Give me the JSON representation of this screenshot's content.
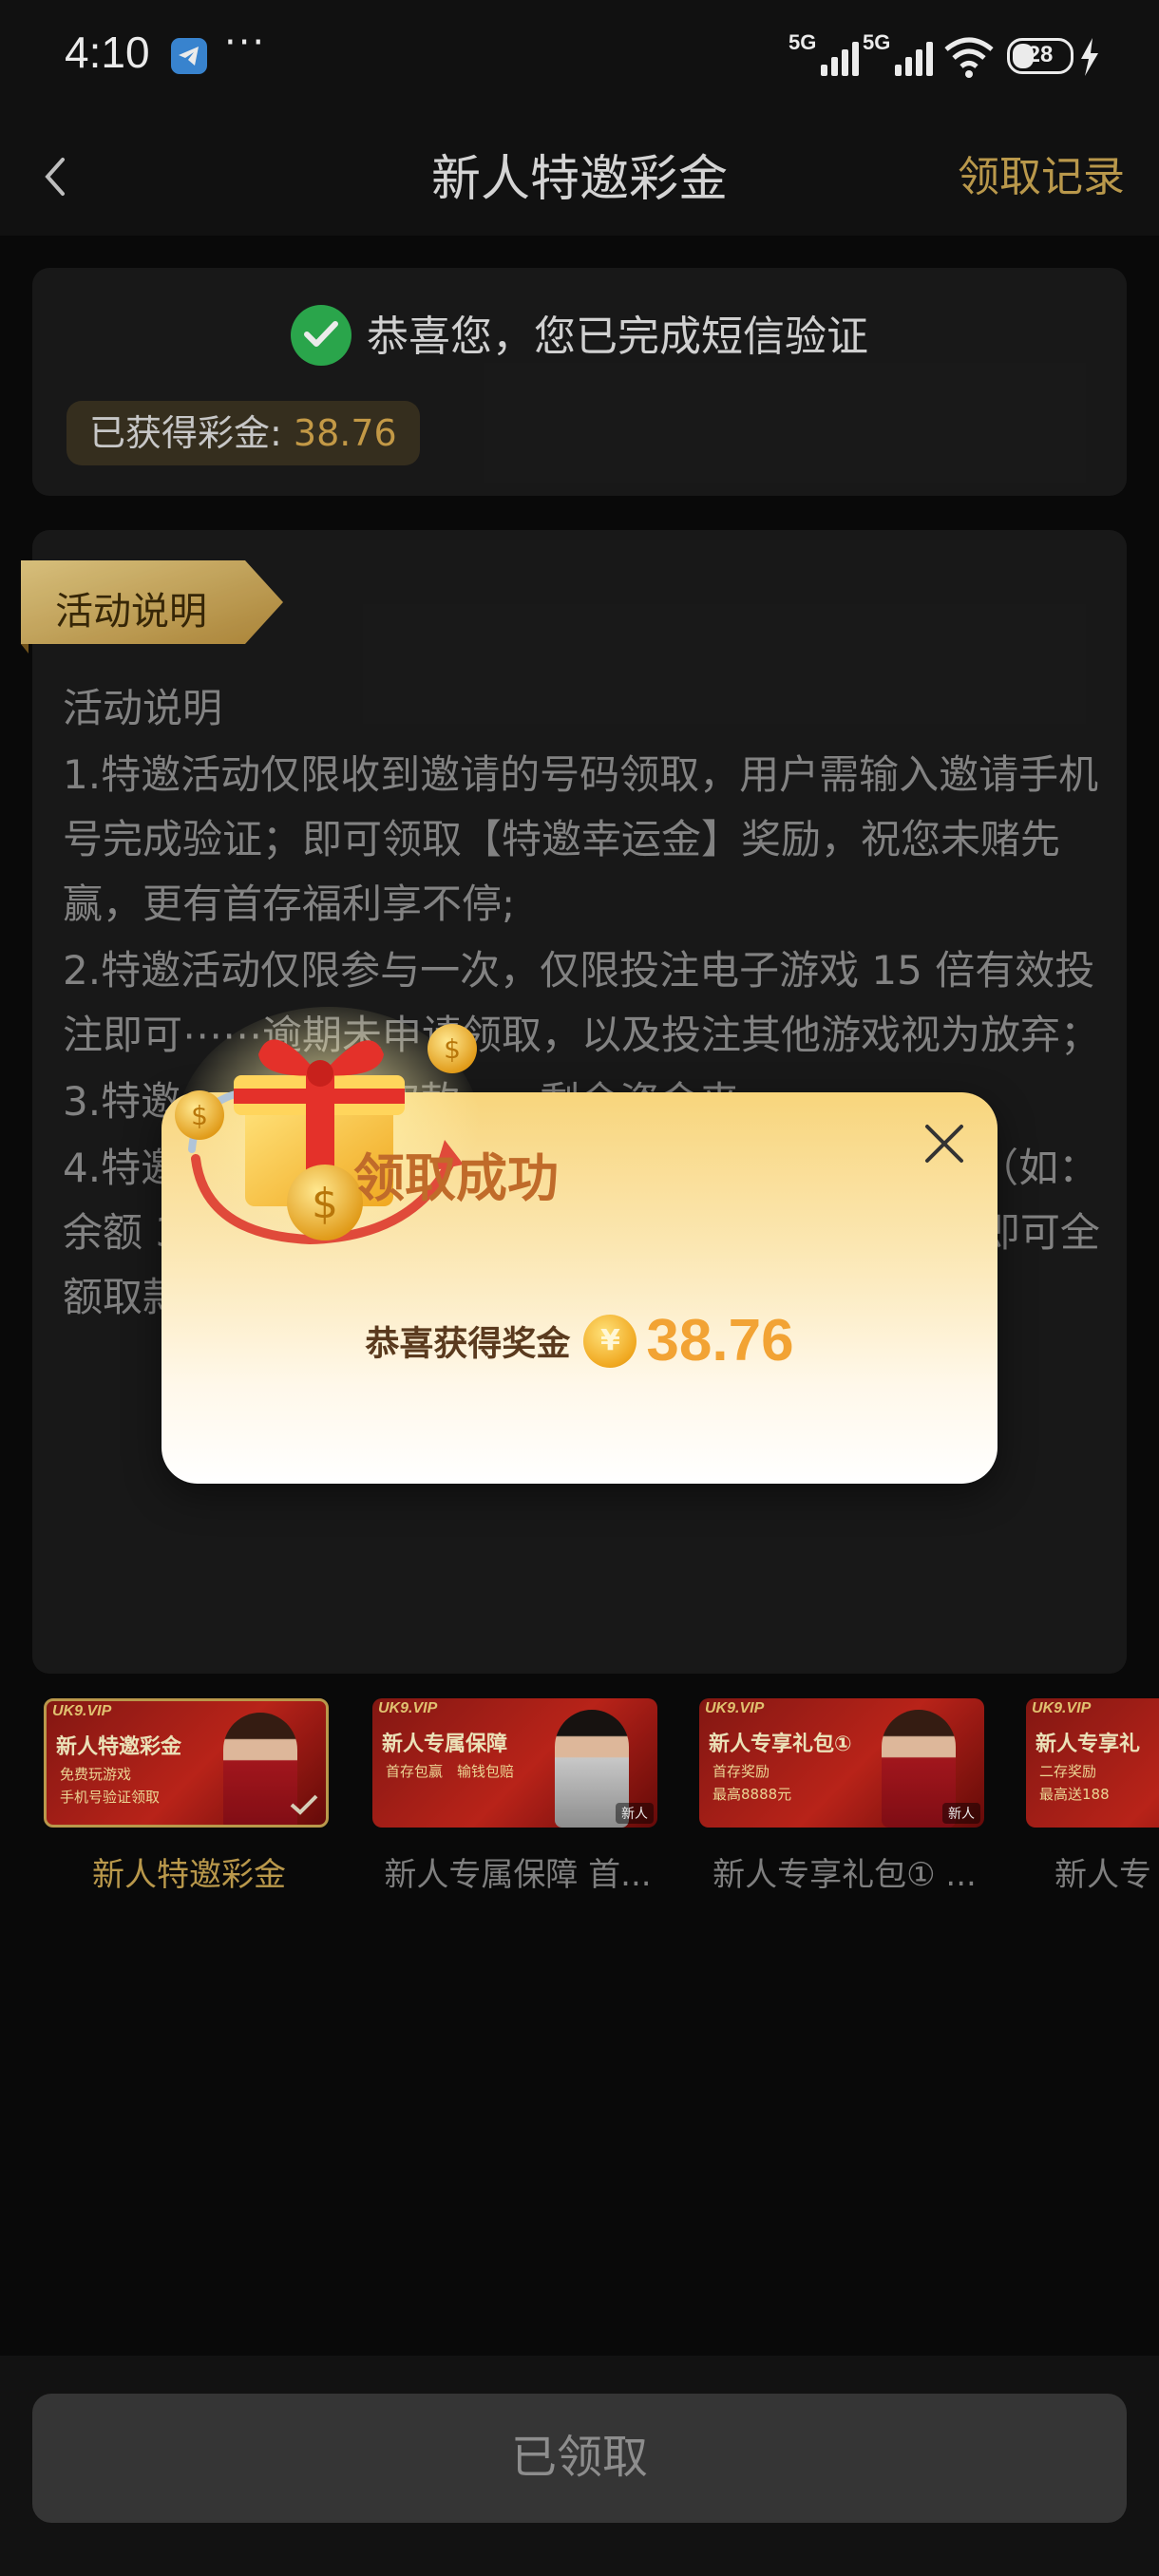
{
  "status_bar": {
    "time": "4:10",
    "network1": "5G",
    "network2": "5G",
    "battery": "28"
  },
  "nav": {
    "title": "新人特邀彩金",
    "record": "领取记录"
  },
  "verify": {
    "message": "恭喜您，您已完成短信验证",
    "bonus_label": "已获得彩金: ",
    "bonus_amount": "38.76"
  },
  "rules": {
    "ribbon": "活动说明",
    "heading": "活动说明",
    "items": [
      "1.特邀活动仅限收到邀请的号码领取，用户需输入邀请手机号完成验证；即可领取【特邀幸运金】奖励，祝您未赌先赢，更有首存福利享不停;",
      "2.特邀活动仅限参与一次，仅限投注电子游戏 15 倍有效投注即可⋯⋯逾期未申请领取，以及投注其他游戏视为放弃；",
      "3.特邀⋯⋯值可以取款⋯⋯剩余资金来⋯⋯",
      "4.特邀⋯⋯值余额同等金额，完成流水即可全额取款（如：余额 388 元，需要充值：388元，完成流水 388 后即可全额取款）"
    ]
  },
  "tabs": [
    {
      "label": "新人特邀彩金",
      "brand": "UK9.VIP",
      "title": "新人特邀彩金",
      "sub1": "免费玩游戏",
      "sub2": "手机号验证领取",
      "badge": "",
      "active": true
    },
    {
      "label": "新人专属保障 首...",
      "brand": "UK9.VIP",
      "title": "新人专属保障",
      "sub1": "首存包赢　输钱包赔",
      "sub2": "",
      "badge": "新人",
      "active": false
    },
    {
      "label": "新人专享礼包① ...",
      "brand": "UK9.VIP",
      "title": "新人专享礼包①",
      "sub1": "首存奖励",
      "sub2": "最高8888元",
      "badge": "新人",
      "active": false
    },
    {
      "label": "新人专",
      "brand": "UK9.VIP",
      "title": "新人专享礼",
      "sub1": "二存奖励",
      "sub2": "最高送188",
      "badge": "",
      "active": false
    }
  ],
  "modal": {
    "title": "领取成功",
    "label": "恭喜获得奖金",
    "currency": "¥",
    "amount": "38.76"
  },
  "bottom": {
    "button": "已领取"
  },
  "colors": {
    "gold": "#c9a552",
    "bg": "#0a0a0a",
    "card": "#1b1b1b",
    "modal_amount": "#f2a334"
  }
}
